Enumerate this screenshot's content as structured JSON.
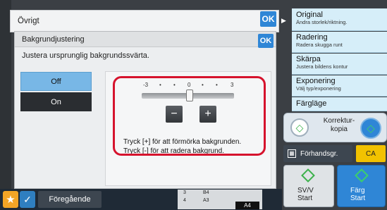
{
  "header": {
    "title": "Övrigt",
    "ok_label": "OK"
  },
  "panel": {
    "title": "Bakgrundjustering",
    "ok_label": "OK",
    "description": "Justera ursprunglig bakgrundssvärta.",
    "options": {
      "off": "Off",
      "on": "On",
      "selected": "Off"
    }
  },
  "adjust": {
    "scale": {
      "min": "-3",
      "mid": "0",
      "max": "3",
      "dot": "•"
    },
    "value": 0,
    "minus_label": "−",
    "plus_label": "+",
    "hint_line1": "Tryck [+] för att förmörka bakgrunden.",
    "hint_line2": "Tryck [-] för att radera bakgrund."
  },
  "sidebar": {
    "items": [
      {
        "title": "Original",
        "sub": "Ändra storlek/riktning."
      },
      {
        "title": "Radering",
        "sub": "Radera skugga runt"
      },
      {
        "title": "Skärpa",
        "sub": "Justera bildens kontur"
      },
      {
        "title": "Exponering",
        "sub": "Välj typ/exponering"
      },
      {
        "title": "Färgläge",
        "sub": ""
      }
    ],
    "korrektur": "Korrektur-\nkopia",
    "preview": "Förhandsgr.",
    "ca": "CA",
    "start_bw": {
      "mode": "SV/V",
      "action": "Start"
    },
    "start_color": {
      "mode": "Färg",
      "action": "Start"
    }
  },
  "bottom": {
    "previous": "Föregående",
    "slots": [
      {
        "num": "3",
        "size": "B4"
      },
      {
        "num": "4",
        "size": "A3"
      }
    ],
    "selected_paper": "A4"
  },
  "colors": {
    "accent_blue": "#2f86d6",
    "highlight_red": "#d6132d",
    "ca_yellow": "#f2c200",
    "sidebar_bg": "#d6eef9"
  }
}
